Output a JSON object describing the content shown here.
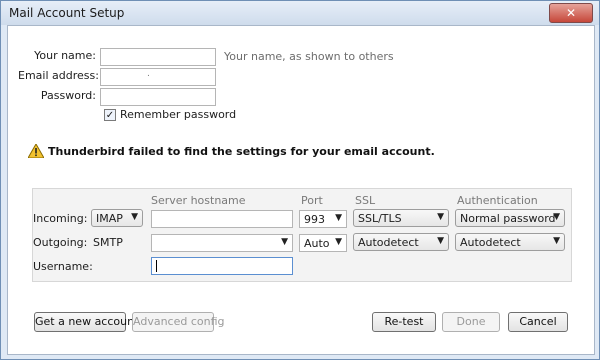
{
  "window": {
    "title": "Mail Account Setup",
    "close_glyph": "✕"
  },
  "form": {
    "name_label": "Your name:",
    "name_hint": "Your name, as shown to others",
    "email_label": "Email address:",
    "email_value": ".",
    "password_label": "Password:",
    "remember_label": "Remember password",
    "remember_checked": "✓"
  },
  "warning": {
    "icon": "warning-icon",
    "text": "Thunderbird failed to find the settings for your email account."
  },
  "server": {
    "headers": {
      "hostname": "Server hostname",
      "port": "Port",
      "ssl": "SSL",
      "auth": "Authentication"
    },
    "incoming": {
      "label": "Incoming:",
      "protocol": "IMAP",
      "hostname": "",
      "port": "993",
      "ssl": "SSL/TLS",
      "auth": "Normal password"
    },
    "outgoing": {
      "label": "Outgoing:",
      "protocol": "SMTP",
      "hostname": "",
      "port": "Auto",
      "ssl": "Autodetect",
      "auth": "Autodetect"
    },
    "username": {
      "label": "Username:",
      "value": ""
    }
  },
  "buttons": {
    "get_account": "Get a new account",
    "advanced": "Advanced config",
    "retest": "Re-test",
    "done": "Done",
    "cancel": "Cancel"
  }
}
